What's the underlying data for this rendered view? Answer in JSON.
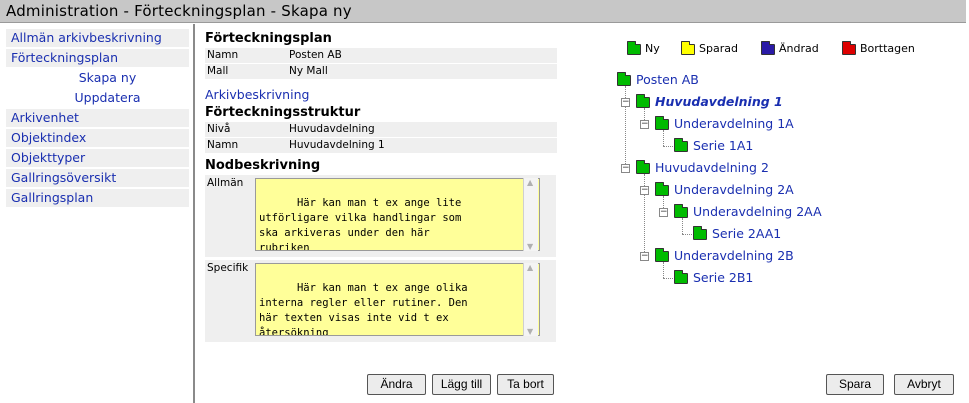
{
  "title": "Administration  -  Förteckningsplan  -  Skapa ny",
  "sidebar": {
    "items": [
      {
        "label": "Allmän arkivbeskrivning"
      },
      {
        "label": "Förteckningsplan"
      },
      {
        "label": "Skapa ny"
      },
      {
        "label": "Uppdatera"
      },
      {
        "label": "Arkivenhet"
      },
      {
        "label": "Objektindex"
      },
      {
        "label": "Objekttyper"
      },
      {
        "label": "Gallringsöversikt"
      },
      {
        "label": "Gallringsplan"
      }
    ]
  },
  "plan": {
    "heading": "Förteckningsplan",
    "rows": [
      {
        "key": "Namn",
        "value": "Posten AB"
      },
      {
        "key": "Mall",
        "value": "Ny Mall"
      }
    ],
    "link": "Arkivbeskrivning"
  },
  "structure": {
    "heading": "Förteckningsstruktur",
    "rows": [
      {
        "key": "Nivå",
        "value": "Huvudavdelning"
      },
      {
        "key": "Namn",
        "value": "Huvudavdelning 1"
      }
    ]
  },
  "node_desc": {
    "heading": "Nodbeskrivning",
    "general_label": "Allmän",
    "general_text": "Här kan man t ex ange lite\nutförligare vilka handlingar som\nska arkiveras under den här\nrubriken",
    "specific_label": "Specifik",
    "specific_text": "Här kan man t ex ange olika\ninterna regler eller rutiner. Den\nhär texten visas inte vid t ex\nåtersökning"
  },
  "buttons": {
    "change": "Ändra",
    "add": "Lägg till",
    "remove": "Ta bort",
    "save": "Spara",
    "cancel": "Avbryt"
  },
  "legend": [
    {
      "label": "Ny",
      "color": "#00bb00"
    },
    {
      "label": "Sparad",
      "color": "#ffff00"
    },
    {
      "label": "Ändrad",
      "color": "#2a1aa6"
    },
    {
      "label": "Borttagen",
      "color": "#dd0000"
    }
  ],
  "tree": {
    "root": "Posten AB",
    "nodes": [
      {
        "label": "Huvudavdelning 1",
        "selected": true,
        "toggle": "−"
      },
      {
        "label": "Underavdelning 1A",
        "toggle": "−"
      },
      {
        "label": "Serie 1A1"
      },
      {
        "label": "Huvudavdelning 2",
        "toggle": "−"
      },
      {
        "label": "Underavdelning 2A",
        "toggle": "−"
      },
      {
        "label": "Underavdelning 2AA",
        "toggle": "−"
      },
      {
        "label": "Serie 2AA1"
      },
      {
        "label": "Underavdelning 2B",
        "toggle": "−"
      },
      {
        "label": "Serie 2B1"
      }
    ]
  }
}
